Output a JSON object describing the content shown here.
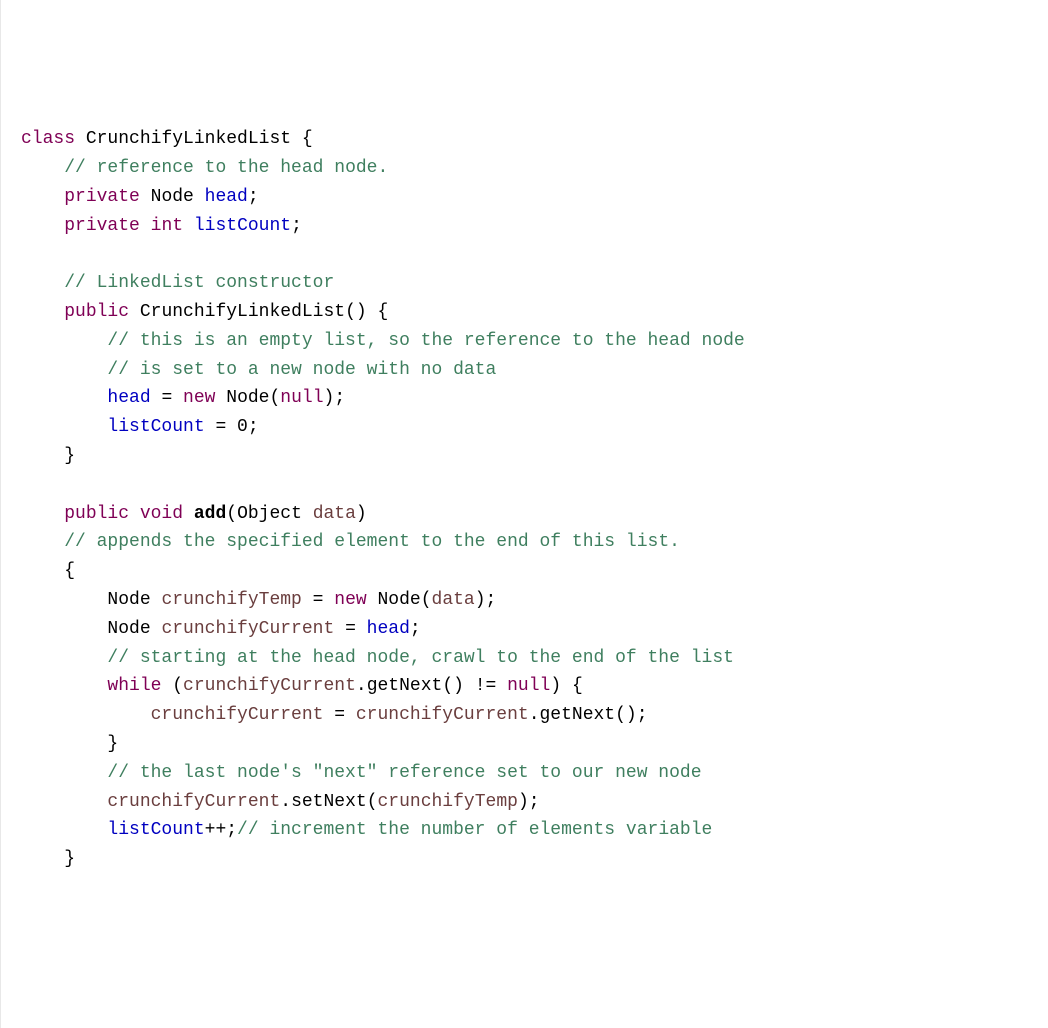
{
  "code": {
    "l01": {
      "kw_class": "class",
      "name": "CrunchifyLinkedList",
      "brace": " {"
    },
    "l02": {
      "indent": "    ",
      "comment": "// reference to the head node."
    },
    "l03": {
      "indent": "    ",
      "kw_private": "private",
      "type": " Node ",
      "field": "head",
      "semi": ";"
    },
    "l04": {
      "indent": "    ",
      "kw_private": "private",
      "kw_int": " int ",
      "field": "listCount",
      "semi": ";"
    },
    "l05": {
      "blank": ""
    },
    "l06": {
      "indent": "    ",
      "comment": "// LinkedList constructor"
    },
    "l07": {
      "indent": "    ",
      "kw_public": "public",
      "space": " ",
      "ctor": "CrunchifyLinkedList",
      "paren": "() {"
    },
    "l08": {
      "indent": "        ",
      "comment": "// this is an empty list, so the reference to the head node"
    },
    "l09": {
      "indent": "        ",
      "comment": "// is set to a new node with no data"
    },
    "l10": {
      "indent": "        ",
      "field": "head",
      "eq": " = ",
      "kw_new": "new",
      "space": " ",
      "type": "Node",
      "paren_open": "(",
      "kw_null": "null",
      "paren_close": ");"
    },
    "l11": {
      "indent": "        ",
      "field": "listCount",
      "eq": " = ",
      "num": "0",
      "semi": ";"
    },
    "l12": {
      "indent": "    ",
      "brace": "}"
    },
    "l13": {
      "blank": ""
    },
    "l14": {
      "indent": "    ",
      "kw_public": "public",
      "kw_void": " void ",
      "method": "add",
      "paren_open": "(",
      "type": "Object ",
      "param": "data",
      "paren_close": ")"
    },
    "l15": {
      "indent": "    ",
      "comment": "// appends the specified element to the end of this list."
    },
    "l16": {
      "indent": "    ",
      "brace": "{"
    },
    "l17": {
      "indent": "        ",
      "type1": "Node ",
      "local1": "crunchifyTemp",
      "eq1": " = ",
      "kw_new": "new",
      "space": " ",
      "type2": "Node",
      "paren_open": "(",
      "param": "data",
      "paren_close": ");"
    },
    "l18": {
      "indent": "        ",
      "type": "Node ",
      "local": "crunchifyCurrent",
      "eq": " = ",
      "field": "head",
      "semi": ";"
    },
    "l19": {
      "indent": "        ",
      "comment": "// starting at the head node, crawl to the end of the list"
    },
    "l20": {
      "indent": "        ",
      "kw_while": "while",
      "paren_open": " (",
      "local": "crunchifyCurrent",
      "dot": ".",
      "method": "getNext",
      "call": "() != ",
      "kw_null": "null",
      "paren_close": ") {"
    },
    "l21": {
      "indent": "            ",
      "local1": "crunchifyCurrent",
      "eq": " = ",
      "local2": "crunchifyCurrent",
      "dot": ".",
      "method": "getNext",
      "call": "();"
    },
    "l22": {
      "indent": "        ",
      "brace": "}"
    },
    "l23": {
      "indent": "        ",
      "comment": "// the last node's \"next\" reference set to our new node"
    },
    "l24": {
      "indent": "        ",
      "local1": "crunchifyCurrent",
      "dot": ".",
      "method": "setNext",
      "paren_open": "(",
      "local2": "crunchifyTemp",
      "paren_close": ");"
    },
    "l25": {
      "indent": "        ",
      "field": "listCount",
      "op": "++;",
      "comment": "// increment the number of elements variable"
    },
    "l26": {
      "indent": "    ",
      "brace": "}"
    }
  }
}
